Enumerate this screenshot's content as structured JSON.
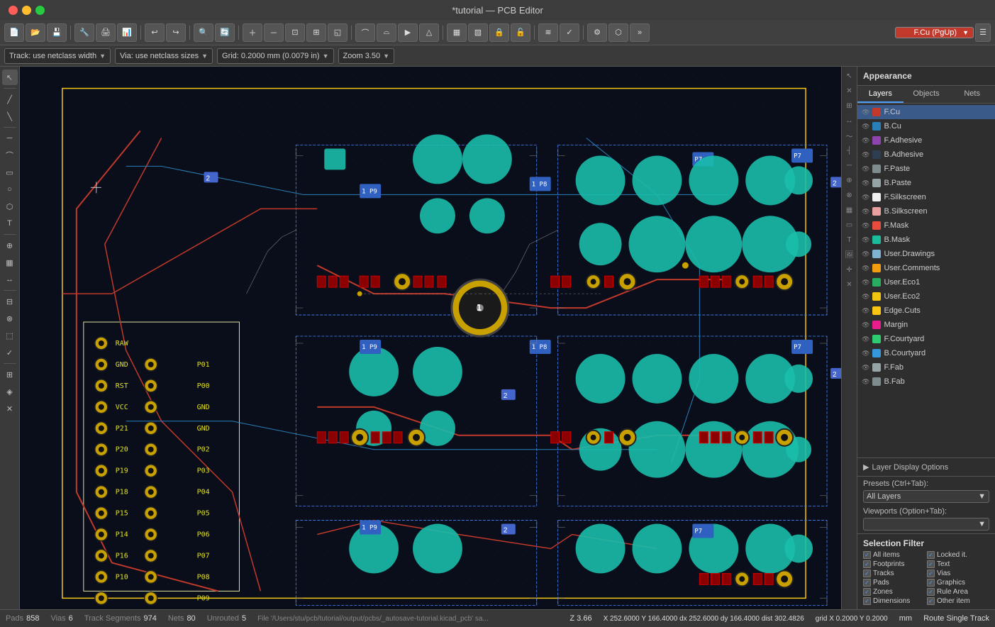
{
  "titlebar": {
    "title": "*tutorial — PCB Editor"
  },
  "toolbar1": {
    "buttons": [
      {
        "name": "new",
        "icon": "📄"
      },
      {
        "name": "open",
        "icon": "📂"
      },
      {
        "name": "save",
        "icon": "💾"
      },
      {
        "name": "drc",
        "icon": "🔧"
      },
      {
        "name": "print",
        "icon": "🖨"
      },
      {
        "name": "plot",
        "icon": "📊"
      },
      {
        "name": "undo",
        "icon": "↩"
      },
      {
        "name": "redo",
        "icon": "↪"
      },
      {
        "name": "search",
        "icon": "🔍"
      },
      {
        "name": "refresh",
        "icon": "🔄"
      },
      {
        "name": "zoom-in",
        "icon": "+"
      },
      {
        "name": "zoom-out",
        "icon": "−"
      },
      {
        "name": "zoom-fit",
        "icon": "⊡"
      },
      {
        "name": "zoom-custom",
        "icon": "⊞"
      },
      {
        "name": "zoom-full",
        "icon": "◱"
      },
      {
        "name": "arc1",
        "icon": "⌒"
      },
      {
        "name": "arc2",
        "icon": "⌓"
      },
      {
        "name": "route",
        "icon": "▶"
      },
      {
        "name": "shape",
        "icon": "△"
      },
      {
        "name": "pad",
        "icon": "⊕"
      },
      {
        "name": "copper-fill",
        "icon": "▦"
      },
      {
        "name": "copper2",
        "icon": "▨"
      },
      {
        "name": "lock",
        "icon": "🔒"
      },
      {
        "name": "unlock",
        "icon": "🔓"
      },
      {
        "name": "ratsnest",
        "icon": "≋"
      },
      {
        "name": "drc2",
        "icon": "✓"
      },
      {
        "name": "settings",
        "icon": "⚙"
      },
      {
        "name": "3d",
        "icon": "⬡"
      },
      {
        "name": "scripting",
        "icon": "»"
      }
    ],
    "active_layer_label": "F.Cu (PgUp)"
  },
  "toolbar2": {
    "track_label": "Track: use netclass width",
    "via_label": "Via: use netclass sizes",
    "grid_label": "Grid: 0.2000 mm (0.0079 in)",
    "zoom_label": "Zoom 3.50"
  },
  "layers": [
    {
      "name": "F.Cu",
      "color": "#c0392b",
      "visible": true,
      "selected": true
    },
    {
      "name": "B.Cu",
      "color": "#2980b9",
      "visible": true,
      "selected": false
    },
    {
      "name": "F.Adhesive",
      "color": "#8e44ad",
      "visible": true,
      "selected": false
    },
    {
      "name": "B.Adhesive",
      "color": "#2c3e50",
      "visible": true,
      "selected": false
    },
    {
      "name": "F.Paste",
      "color": "#7f8c8d",
      "visible": true,
      "selected": false
    },
    {
      "name": "B.Paste",
      "color": "#95a5a6",
      "visible": true,
      "selected": false
    },
    {
      "name": "F.Silkscreen",
      "color": "#f0f0f0",
      "visible": true,
      "selected": false
    },
    {
      "name": "B.Silkscreen",
      "color": "#e8a0a0",
      "visible": true,
      "selected": false
    },
    {
      "name": "F.Mask",
      "color": "#e74c3c",
      "visible": true,
      "selected": false
    },
    {
      "name": "B.Mask",
      "color": "#1abc9c",
      "visible": true,
      "selected": false
    },
    {
      "name": "User.Drawings",
      "color": "#7fb3d3",
      "visible": true,
      "selected": false
    },
    {
      "name": "User.Comments",
      "color": "#f39c12",
      "visible": true,
      "selected": false
    },
    {
      "name": "User.Eco1",
      "color": "#27ae60",
      "visible": true,
      "selected": false
    },
    {
      "name": "User.Eco2",
      "color": "#f1c40f",
      "visible": true,
      "selected": false
    },
    {
      "name": "Edge.Cuts",
      "color": "#f9c513",
      "visible": true,
      "selected": false
    },
    {
      "name": "Margin",
      "color": "#e91e8c",
      "visible": true,
      "selected": false
    },
    {
      "name": "F.Courtyard",
      "color": "#2ecc71",
      "visible": true,
      "selected": false
    },
    {
      "name": "B.Courtyard",
      "color": "#3498db",
      "visible": true,
      "selected": false
    },
    {
      "name": "F.Fab",
      "color": "#95a5a6",
      "visible": true,
      "selected": false
    },
    {
      "name": "B.Fab",
      "color": "#7f8c8d",
      "visible": true,
      "selected": false
    }
  ],
  "appearance": {
    "title": "Appearance",
    "tabs": [
      "Layers",
      "Objects",
      "Nets"
    ],
    "active_tab": "Layers",
    "layer_display_options": "Layer Display Options",
    "presets_label": "Presets (Ctrl+Tab):",
    "presets_value": "All Layers",
    "viewports_label": "Viewports (Option+Tab):"
  },
  "selection_filter": {
    "title": "Selection Filter",
    "items": [
      {
        "label": "All items",
        "checked": true
      },
      {
        "label": "Locked it.",
        "checked": true
      },
      {
        "label": "Footprints",
        "checked": true
      },
      {
        "label": "Text",
        "checked": true
      },
      {
        "label": "Tracks",
        "checked": true
      },
      {
        "label": "Vias",
        "checked": true
      },
      {
        "label": "Pads",
        "checked": true
      },
      {
        "label": "Graphics",
        "checked": true
      },
      {
        "label": "Zones",
        "checked": true
      },
      {
        "label": "Rule Area",
        "checked": true
      },
      {
        "label": "Dimensions",
        "checked": true
      },
      {
        "label": "Other item",
        "checked": true
      }
    ]
  },
  "statusbar": {
    "pads_label": "Pads",
    "pads_value": "858",
    "vias_label": "Vias",
    "vias_value": "6",
    "track_label": "Track Segments",
    "track_value": "974",
    "nets_label": "Nets",
    "nets_value": "80",
    "unrouted_label": "Unrouted",
    "unrouted_value": "5",
    "coords": "X 252.6000  Y 166.4000   dx 252.6000  dy 166.4000  dist 302.4826",
    "grid": "grid X 0.2000  Y 0.2000",
    "unit": "mm",
    "route_mode": "Route Single Track",
    "zoom": "Z 3.66",
    "filepath": "File '/Users/stu/pcb/tutorial/output/pcbs/_autosave-tutorial.kicad_pcb' sa..."
  }
}
